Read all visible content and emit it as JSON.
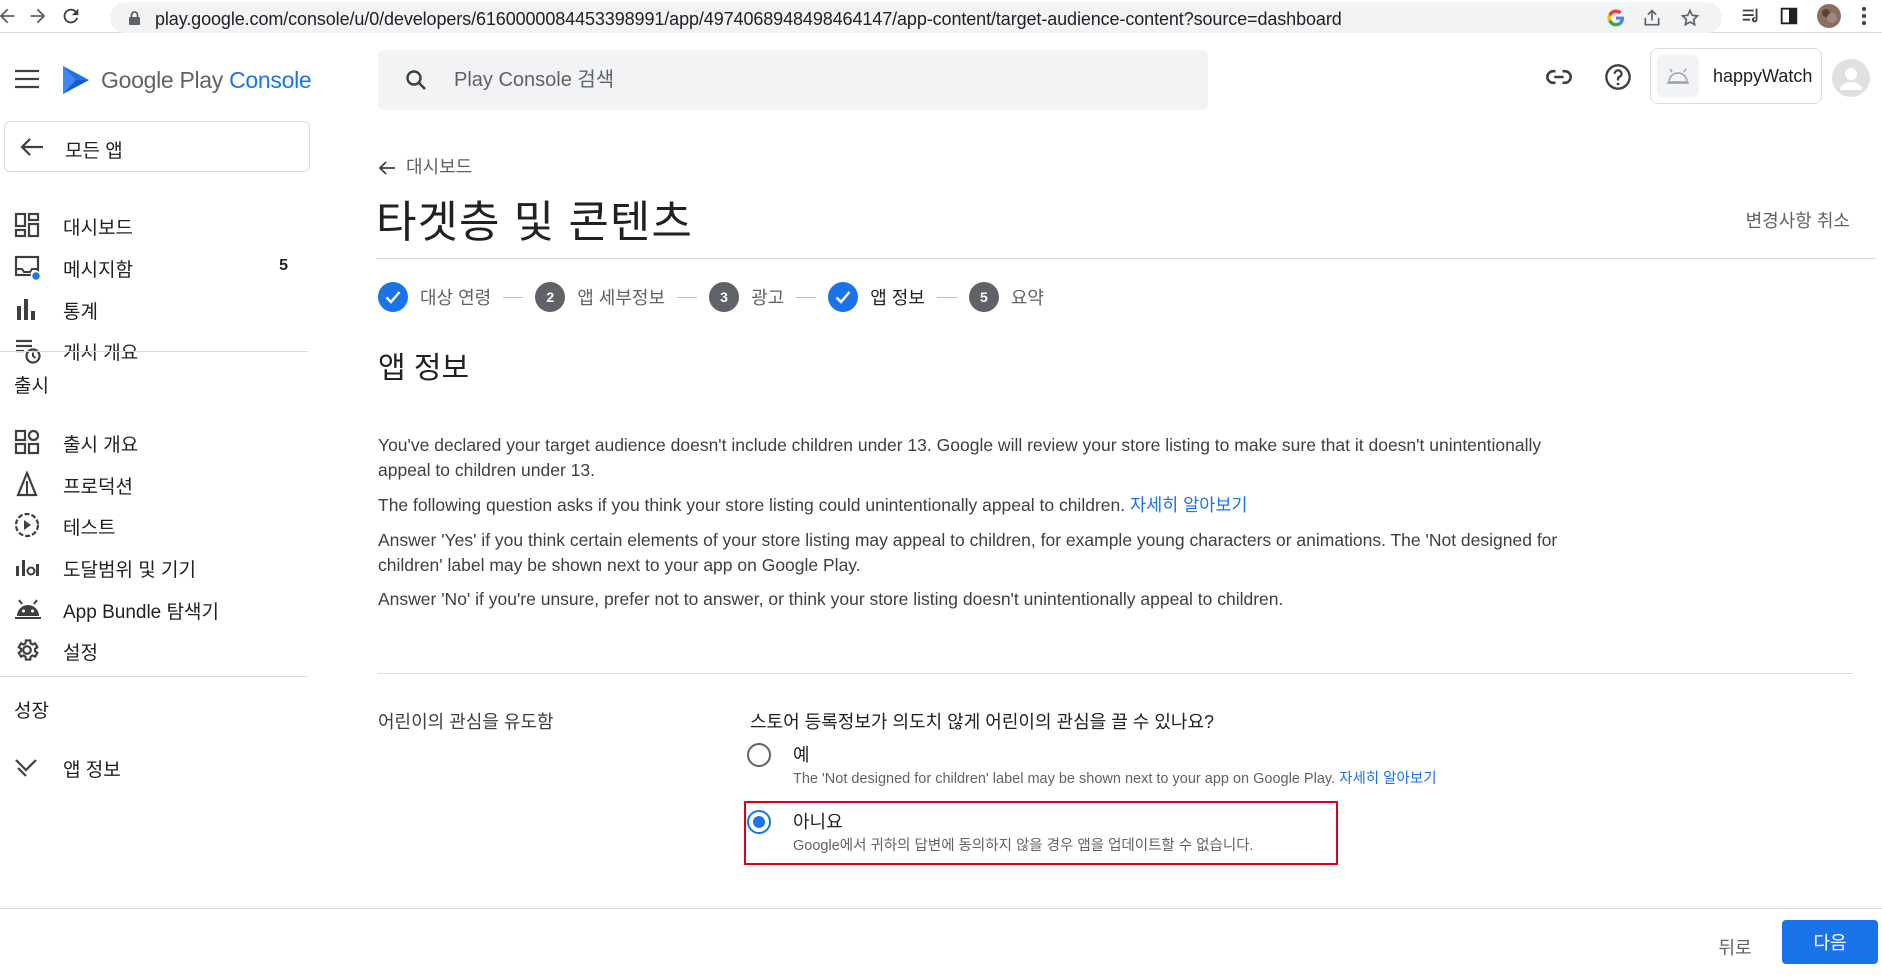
{
  "browser": {
    "url": "play.google.com/console/u/0/developers/6160000084453398991/app/4974068948498464147/app-content/target-audience-content?source=dashboard"
  },
  "header": {
    "logo_text_main": "Google Play ",
    "logo_text_accent": "Console",
    "search_placeholder": "Play Console 검색",
    "account_name": "happyWatch"
  },
  "sidebar": {
    "all_apps": "모든 앱",
    "items": [
      {
        "label": "대시보드",
        "icon": "dashboard-icon"
      },
      {
        "label": "메시지함",
        "icon": "inbox-icon",
        "count": "5"
      },
      {
        "label": "통계",
        "icon": "bar-chart-icon"
      },
      {
        "label": "게시 개요",
        "icon": "publishing-overview-icon"
      }
    ],
    "release_section": "출시",
    "release_items": [
      {
        "label": "출시 개요",
        "icon": "release-overview-icon"
      },
      {
        "label": "프로덕션",
        "icon": "production-icon"
      },
      {
        "label": "테스트",
        "icon": "testing-icon"
      },
      {
        "label": "도달범위 및 기기",
        "icon": "reach-devices-icon"
      },
      {
        "label": "App Bundle 탐색기",
        "icon": "android-icon"
      },
      {
        "label": "설정",
        "icon": "settings-icon"
      }
    ],
    "growth_section": "성장",
    "growth_items": [
      {
        "label": "앱 정보",
        "icon": "store-presence-icon"
      }
    ]
  },
  "main": {
    "back_label": "대시보드",
    "title": "타겟층 및 콘텐츠",
    "discard_label": "변경사항 취소",
    "steps": [
      {
        "label": "대상 연령",
        "status": "done",
        "number": "1"
      },
      {
        "label": "앱 세부정보",
        "status": "todo",
        "number": "2"
      },
      {
        "label": "광고",
        "status": "todo",
        "number": "3"
      },
      {
        "label": "앱 정보",
        "status": "done",
        "number": "4"
      },
      {
        "label": "요약",
        "status": "todo",
        "number": "5"
      }
    ],
    "section_title": "앱 정보",
    "para1": "You've declared your target audience doesn't include children under 13. Google will review your store listing to make sure that it doesn't unintentionally appeal to children under 13.",
    "para2_text": "The following question asks if you think your store listing could unintentionally appeal to children. ",
    "para2_link": "자세히 알아보기",
    "para3": "Answer 'Yes' if you think certain elements of your store listing may appeal to children, for example young characters or animations. The 'Not designed for children' label may be shown next to your app on Google Play.",
    "para4": "Answer 'No' if you're unsure, prefer not to answer, or think your store listing doesn't unintentionally appeal to children.",
    "field_label": "어린이의 관심을 유도함",
    "question": "스토어 등록정보가 의도치 않게 어린이의 관심을 끌 수 있나요?",
    "option_yes": {
      "label": "예",
      "desc": "The 'Not designed for children' label may be shown next to your app on Google Play. ",
      "desc_link": "자세히 알아보기",
      "checked": false
    },
    "option_no": {
      "label": "아니요",
      "desc": "Google에서 귀하의 답변에 동의하지 않을 경우 앱을 업데이트할 수 없습니다.",
      "checked": true
    }
  },
  "footer": {
    "back": "뒤로",
    "next": "다음"
  },
  "colors": {
    "accent": "#1a73e8",
    "highlight": "#d9001b"
  }
}
